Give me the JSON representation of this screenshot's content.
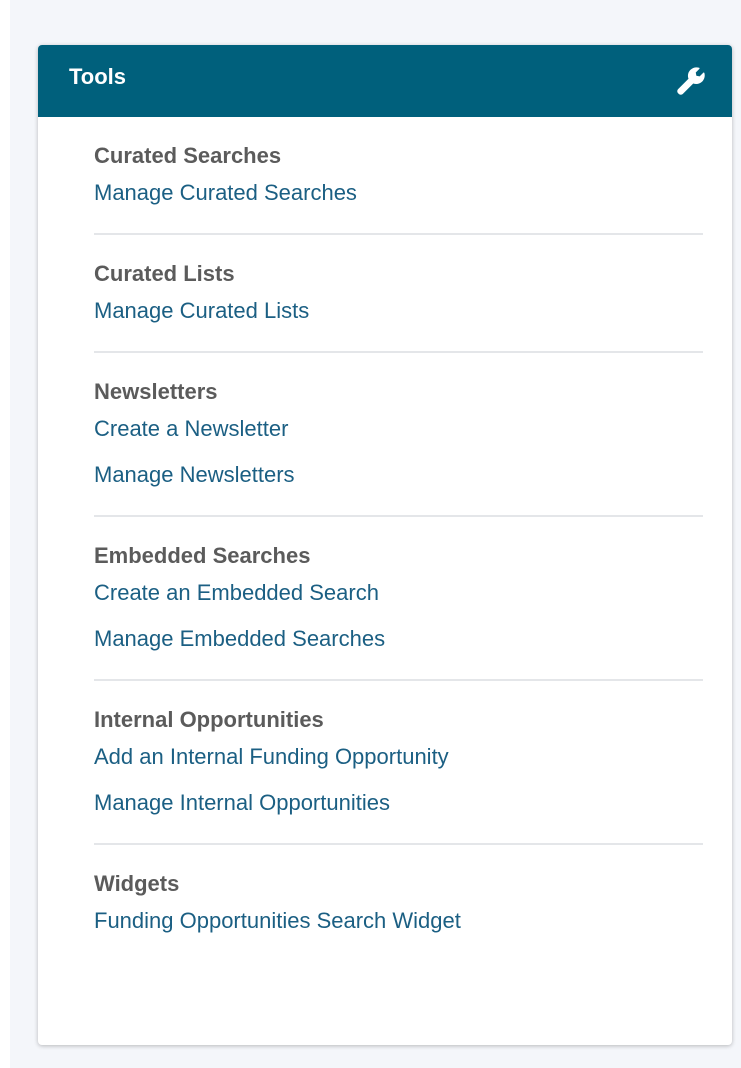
{
  "panel": {
    "title": "Tools",
    "icon": "wrench-icon",
    "header_color": "#00607c",
    "link_color": "#1b5f83",
    "heading_color": "#5b5b5b"
  },
  "sections": [
    {
      "heading": "Curated Searches",
      "links": [
        "Manage Curated Searches"
      ]
    },
    {
      "heading": "Curated Lists",
      "links": [
        "Manage Curated Lists"
      ]
    },
    {
      "heading": "Newsletters",
      "links": [
        "Create a Newsletter",
        "Manage Newsletters"
      ]
    },
    {
      "heading": "Embedded Searches",
      "links": [
        "Create an Embedded Search",
        "Manage Embedded Searches"
      ]
    },
    {
      "heading": "Internal Opportunities",
      "links": [
        "Add an Internal Funding Opportunity",
        "Manage Internal Opportunities"
      ]
    },
    {
      "heading": "Widgets",
      "links": [
        "Funding Opportunities Search Widget"
      ]
    }
  ]
}
